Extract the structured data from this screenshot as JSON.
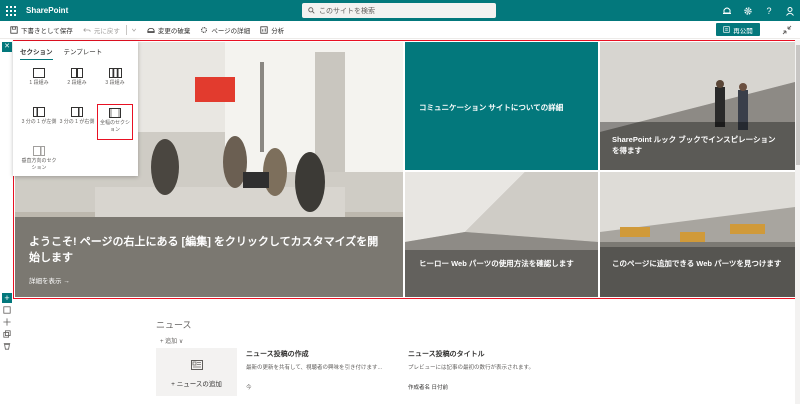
{
  "suite": {
    "brand": "SharePoint",
    "search_placeholder": "このサイトを検索",
    "help": "?",
    "accent": "#03787c"
  },
  "commandbar": {
    "save_draft": "下書きとして保存",
    "undo": "元に戻す",
    "discard": "変更の破棄",
    "page_details": "ページの詳細",
    "analytics": "分析",
    "republish": "再公開"
  },
  "picker": {
    "tabs": [
      "セクション",
      "テンプレート"
    ],
    "options": [
      {
        "label": "1 段組み",
        "icon": "one-column-icon"
      },
      {
        "label": "2 段組み",
        "icon": "two-column-icon"
      },
      {
        "label": "3 段組み",
        "icon": "three-column-icon"
      },
      {
        "label": "3 分の 1 が左側",
        "icon": "one-third-left-icon"
      },
      {
        "label": "3 分の 1 が右側",
        "icon": "one-third-right-icon"
      },
      {
        "label": "全幅のセクション",
        "icon": "full-width-icon"
      },
      {
        "label": "垂直方向のセクション",
        "icon": "vertical-section-icon"
      }
    ]
  },
  "hero": {
    "main_title": "ようこそ! ページの右上にある [編集] をクリックしてカスタマイズを開始します",
    "main_link": "詳細を表示 →",
    "tile1": "コミュニケーション サイトについての詳細",
    "tile2": "SharePoint ルック ブックでインスピレーションを得ます",
    "tile3": "ヒーロー Web パーツの使用方法を確認します",
    "tile4": "このページに追加できる Web パーツを見つけます"
  },
  "news": {
    "title": "ニュース",
    "add": "+ 追加 ∨",
    "add_card": "+ ニュースの追加",
    "post1_title": "ニュース投稿の作成",
    "post1_desc": "最新の更新を共有して、視聴者の興味を引き付けます...",
    "post1_meta": "今",
    "post2_title": "ニュース投稿のタイトル",
    "post2_desc": "プレビューには記事の最初の数行が表示されます。",
    "post2_meta": "作成者名  日付前"
  }
}
